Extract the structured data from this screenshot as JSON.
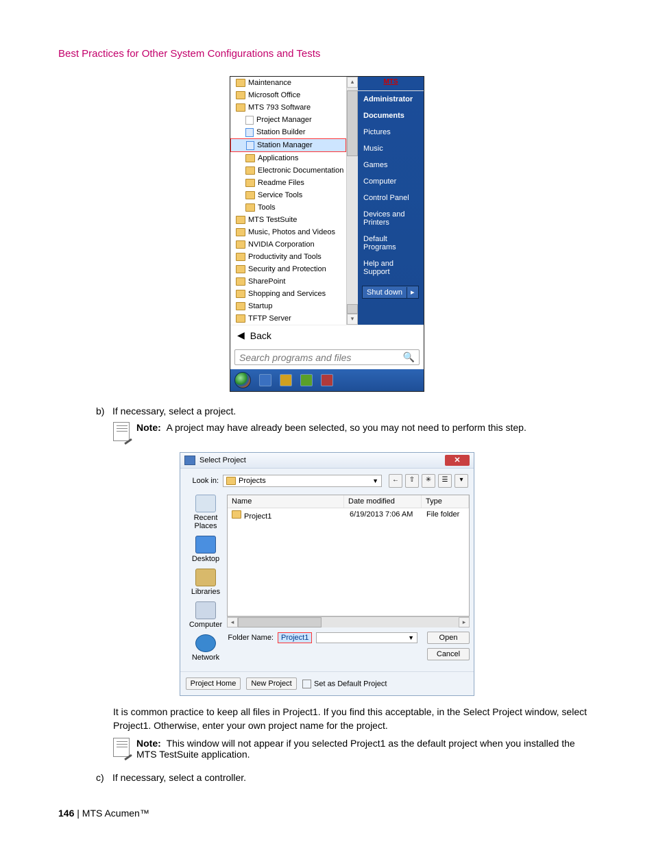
{
  "header": {
    "title": "Best Practices for Other System Configurations and Tests"
  },
  "startmenu": {
    "logo_label": "MTS",
    "left_items": [
      {
        "label": "Maintenance",
        "indent": 0,
        "hl": false
      },
      {
        "label": "Microsoft Office",
        "indent": 0,
        "hl": false
      },
      {
        "label": "MTS 793 Software",
        "indent": 0,
        "hl": false
      },
      {
        "label": "Project Manager",
        "indent": 1,
        "hl": false,
        "icon": "file"
      },
      {
        "label": "Station Builder",
        "indent": 1,
        "hl": false,
        "icon": "fileblue"
      },
      {
        "label": "Station Manager",
        "indent": 1,
        "hl": true,
        "icon": "fileblue"
      },
      {
        "label": "Applications",
        "indent": 1,
        "hl": false
      },
      {
        "label": "Electronic Documentation",
        "indent": 1,
        "hl": false
      },
      {
        "label": "Readme Files",
        "indent": 1,
        "hl": false
      },
      {
        "label": "Service Tools",
        "indent": 1,
        "hl": false
      },
      {
        "label": "Tools",
        "indent": 1,
        "hl": false
      },
      {
        "label": "MTS TestSuite",
        "indent": 0,
        "hl": false
      },
      {
        "label": "Music, Photos and Videos",
        "indent": 0,
        "hl": false
      },
      {
        "label": "NVIDIA Corporation",
        "indent": 0,
        "hl": false
      },
      {
        "label": "Productivity and Tools",
        "indent": 0,
        "hl": false
      },
      {
        "label": "Security and Protection",
        "indent": 0,
        "hl": false
      },
      {
        "label": "SharePoint",
        "indent": 0,
        "hl": false
      },
      {
        "label": "Shopping and Services",
        "indent": 0,
        "hl": false
      },
      {
        "label": "Startup",
        "indent": 0,
        "hl": false
      },
      {
        "label": "TFTP Server",
        "indent": 0,
        "hl": false
      }
    ],
    "right_items": [
      "Administrator",
      "Documents",
      "Pictures",
      "Music",
      "Games",
      "Computer",
      "Control Panel",
      "Devices and Printers",
      "Default Programs",
      "Help and Support"
    ],
    "back_label": "Back",
    "search_placeholder": "Search programs and files",
    "shutdown_label": "Shut down"
  },
  "step_b": {
    "letter": "b)",
    "text": "If necessary, select a project."
  },
  "note1": {
    "prefix": "Note:",
    "text": "A project may have already been selected, so you may not need to perform this step."
  },
  "dialog": {
    "title": "Select Project",
    "lookin_label": "Look in:",
    "lookin_value": "Projects",
    "nav_icons": [
      "←",
      "⇧",
      "✳",
      "☰",
      "▾"
    ],
    "side": [
      {
        "icon": "recent",
        "label": "Recent Places"
      },
      {
        "icon": "desktop",
        "label": "Desktop"
      },
      {
        "icon": "lib",
        "label": "Libraries"
      },
      {
        "icon": "comp",
        "label": "Computer"
      },
      {
        "icon": "net",
        "label": "Network"
      }
    ],
    "columns": [
      "Name",
      "Date modified",
      "Type"
    ],
    "row": {
      "name": "Project1",
      "date": "6/19/2013 7:06 AM",
      "type": "File folder"
    },
    "foldername_label": "Folder Name:",
    "foldername_value": "Project1",
    "open": "Open",
    "cancel": "Cancel",
    "project_home": "Project Home",
    "new_project": "New Project",
    "default_chk": "Set as Default Project"
  },
  "para1": "It is common practice to keep all files in Project1. If you find this acceptable, in the Select Project window, select Project1. Otherwise, enter your own project name for the project.",
  "note2": {
    "prefix": "Note:",
    "text": "This window will not appear if you selected Project1 as the default project when you installed the MTS TestSuite application."
  },
  "step_c": {
    "letter": "c)",
    "text": "If necessary, select a controller."
  },
  "footer": {
    "page": "146",
    "sep": " | ",
    "product": "MTS Acumen",
    "tm": "™"
  }
}
